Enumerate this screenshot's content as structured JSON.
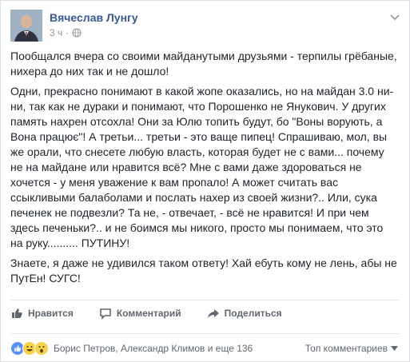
{
  "post": {
    "author": "Вячеслав Лунгу",
    "time": "3 ч",
    "paragraphs": [
      "Пообщался вчера со своими майданутыми друзьями - терпилы грёбаные, нихера до них так и не дошло!",
      "Одни, прекрасно понимают в какой жопе оказались, но на майдан 3.0 ни-ни, так как не дураки и понимают, что Порошенко не Янукович. У других память нахрен отсохла! Они за Юлю топить будут, бо \"Воны ворують, а Вона працює\"! А третьи... третьи - это ваще пипец! Спрашиваю, мол, вы же орали, что снесете любую власть, которая будет не с вами... почему не на майдане или нравится всё? Мне с вами даже здороваться не хочется - у меня уважение к вам пропало! А может считать вас ссыкливыми балаболами и послать нахер из своей жизни?.. Или, сука печенек не подвезли? Та не, - отвечает, - всё не нравится! И при чем здесь печеньки?.. и не боимся мы никого, просто мы понимаем, что это на руку.......... ПУТИНУ!",
      "Знаете, я даже не удивился таком ответу! Хай ебуть кому не лень, абы не ПутЕн! СУГС!"
    ]
  },
  "actions": {
    "like": "Нравится",
    "comment": "Комментарий",
    "share": "Поделиться"
  },
  "footer": {
    "reactors": "Борис Петров, Александр Климов и еще 136",
    "top_comments": "Топ комментариев"
  },
  "colors": {
    "link": "#385898",
    "like_blue": "#5890ff",
    "haha_yellow": "#f7d34a"
  }
}
